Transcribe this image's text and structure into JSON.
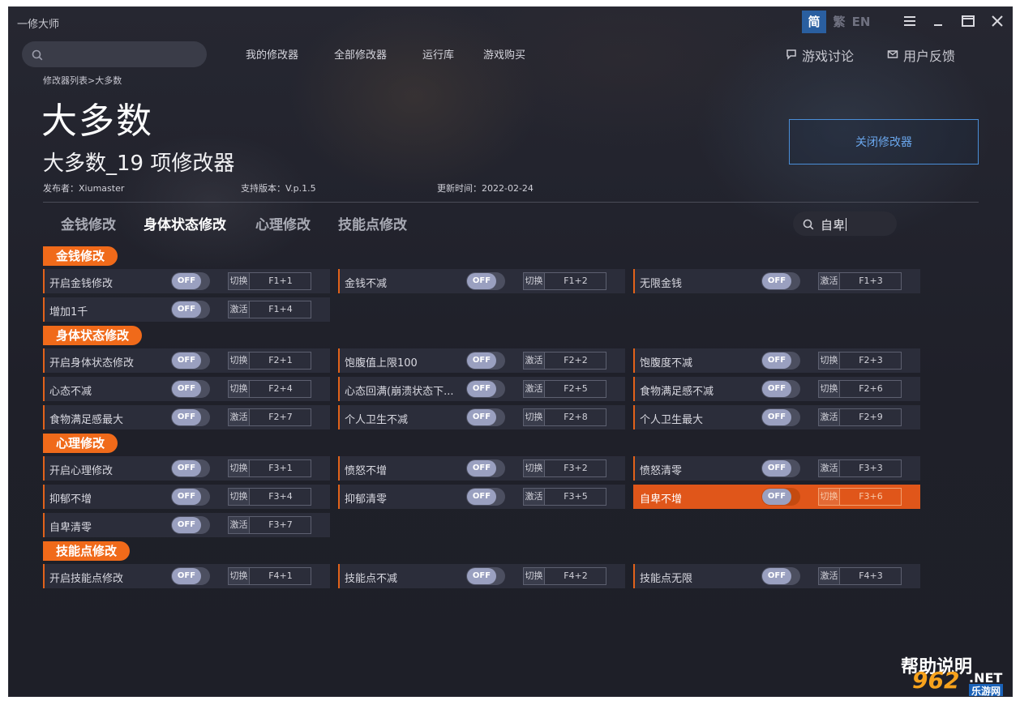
{
  "app": {
    "title": "一修大师"
  },
  "lang": {
    "simplified": "简",
    "traditional": "繁",
    "english": "EN"
  },
  "nav": {
    "links": [
      "我的修改器",
      "全部修改器",
      "运行库",
      "游戏购买"
    ],
    "discuss": "游戏讨论",
    "feedback": "用户反馈"
  },
  "header": {
    "breadcrumb": "修改器列表>大多数",
    "title": "大多数",
    "subtitle": "大多数_19 项修改器",
    "publisher": "发布者：Xiumaster",
    "version": "支持版本：V.p.1.5",
    "updated": "更新时间：2022-02-24",
    "close_button": "关闭修改器"
  },
  "tabs": [
    "金钱修改",
    "身体状态修改",
    "心理修改",
    "技能点修改"
  ],
  "filter": {
    "value": "自卑"
  },
  "toggle_label": "OFF",
  "sections": [
    {
      "label": "金钱修改",
      "cheats": [
        {
          "name": "开启金钱修改",
          "mode": "切换",
          "key": "F1+1",
          "on": false
        },
        {
          "name": "金钱不减",
          "mode": "切换",
          "key": "F1+2",
          "on": false
        },
        {
          "name": "无限金钱",
          "mode": "激活",
          "key": "F1+3",
          "on": false
        },
        {
          "name": "增加1千",
          "mode": "激活",
          "key": "F1+4",
          "on": false
        }
      ]
    },
    {
      "label": "身体状态修改",
      "cheats": [
        {
          "name": "开启身体状态修改",
          "mode": "切换",
          "key": "F2+1",
          "on": false
        },
        {
          "name": "饱腹值上限100",
          "mode": "激活",
          "key": "F2+2",
          "on": false
        },
        {
          "name": "饱腹度不减",
          "mode": "切换",
          "key": "F2+3",
          "on": false
        },
        {
          "name": "心态不减",
          "mode": "切换",
          "key": "F2+4",
          "on": false
        },
        {
          "name": "心态回满(崩溃状态下...",
          "mode": "激活",
          "key": "F2+5",
          "on": false
        },
        {
          "name": "食物满足感不减",
          "mode": "切换",
          "key": "F2+6",
          "on": false
        },
        {
          "name": "食物满足感最大",
          "mode": "激活",
          "key": "F2+7",
          "on": false
        },
        {
          "name": "个人卫生不减",
          "mode": "切换",
          "key": "F2+8",
          "on": false
        },
        {
          "name": "个人卫生最大",
          "mode": "激活",
          "key": "F2+9",
          "on": false
        }
      ]
    },
    {
      "label": "心理修改",
      "cheats": [
        {
          "name": "开启心理修改",
          "mode": "切换",
          "key": "F3+1",
          "on": false
        },
        {
          "name": "愤怒不增",
          "mode": "切换",
          "key": "F3+2",
          "on": false
        },
        {
          "name": "愤怒清零",
          "mode": "激活",
          "key": "F3+3",
          "on": false
        },
        {
          "name": "抑郁不增",
          "mode": "切换",
          "key": "F3+4",
          "on": false
        },
        {
          "name": "抑郁清零",
          "mode": "激活",
          "key": "F3+5",
          "on": false
        },
        {
          "name": "自卑不增",
          "mode": "切换",
          "key": "F3+6",
          "on": false,
          "highlighted": true
        },
        {
          "name": "自卑清零",
          "mode": "激活",
          "key": "F3+7",
          "on": false
        }
      ]
    },
    {
      "label": "技能点修改",
      "cheats": [
        {
          "name": "开启技能点修改",
          "mode": "切换",
          "key": "F4+1",
          "on": false
        },
        {
          "name": "技能点不减",
          "mode": "切换",
          "key": "F4+2",
          "on": false
        },
        {
          "name": "技能点无限",
          "mode": "激活",
          "key": "F4+3",
          "on": false
        }
      ]
    }
  ],
  "help": "帮助说明",
  "watermark": {
    "number": "962",
    "suffix": ".NET",
    "cn": "乐游网"
  },
  "colors": {
    "accent": "#f06a1a",
    "highlight_row": "#e0561a",
    "link_blue": "#6aa6ec",
    "lang_active": "#2a5fa0"
  }
}
